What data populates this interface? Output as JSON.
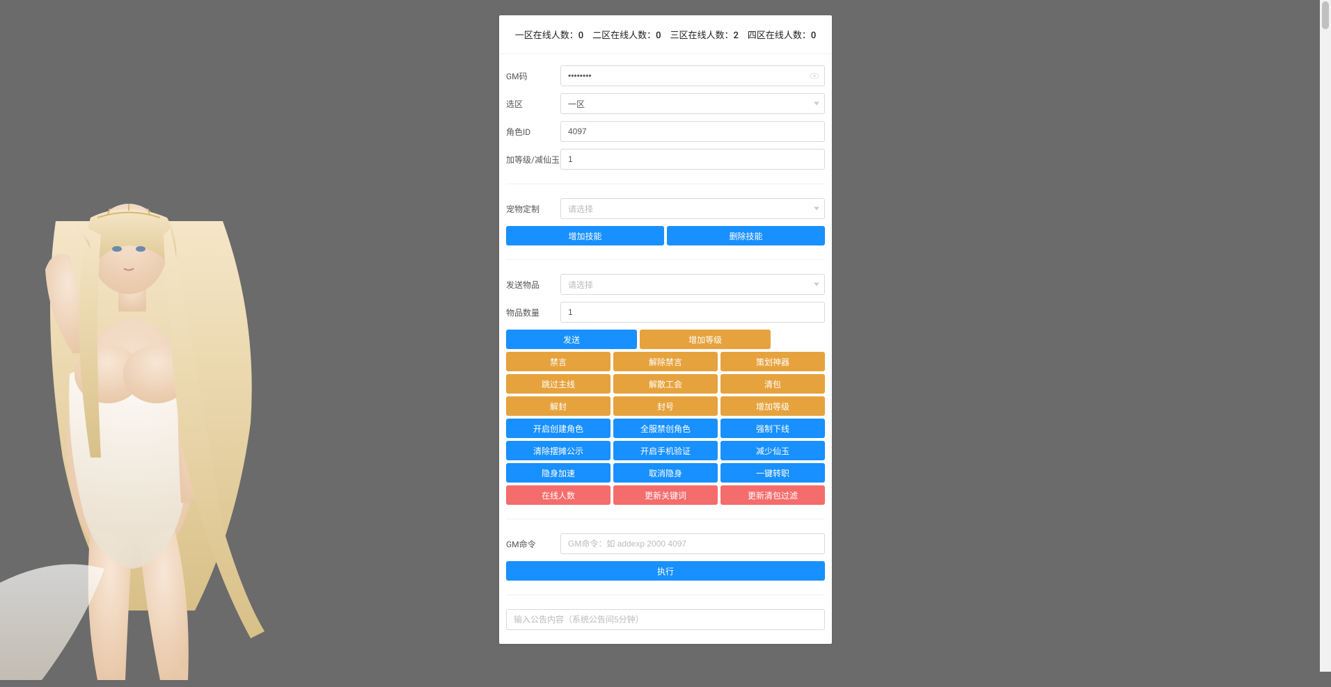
{
  "header": {
    "stats_text": "一区在线人数：0　二区在线人数：0　三区在线人数：2　四区在线人数：0"
  },
  "form": {
    "gm_code_label": "GM码",
    "gm_code_value": "••••••••",
    "zone_label": "选区",
    "zone_value": "一区",
    "role_id_label": "角色ID",
    "role_id_value": "4097",
    "level_jade_label": "加等级/减仙玉",
    "level_jade_value": "1",
    "pet_custom_label": "宠物定制",
    "pet_custom_placeholder": "请选择",
    "send_item_label": "发送物品",
    "send_item_placeholder": "请选择",
    "item_count_label": "物品数量",
    "item_count_value": "1",
    "gm_command_label": "GM命令",
    "gm_command_placeholder": "GM命令：如 addexp 2000 4097",
    "announcement_placeholder": "输入公告内容（系统公告间5分钟）"
  },
  "buttons": {
    "add_skill": "增加技能",
    "delete_skill": "删除技能",
    "send": "发送",
    "add_level": "增加等级",
    "ban_chat": "禁言",
    "unban_chat": "解除禁言",
    "plan_artifact": "策划神器",
    "skip_main": "跳过主线",
    "disband_guild": "解散工会",
    "clear_bag": "清包",
    "unseal": "解封",
    "seal": "封号",
    "add_level2": "增加等级",
    "open_create_role": "开启创建角色",
    "server_ban_create": "全服禁创角色",
    "force_offline": "强制下线",
    "clear_stall": "清除摆摊公示",
    "open_phone_verify": "开启手机验证",
    "reduce_jade": "减少仙玉",
    "stealth_speed": "隐身加速",
    "cancel_stealth": "取消隐身",
    "one_click_job": "一键转职",
    "online_count": "在线人数",
    "update_keywords": "更新关键词",
    "update_bag_filter": "更新清包过滤",
    "execute": "执行"
  }
}
